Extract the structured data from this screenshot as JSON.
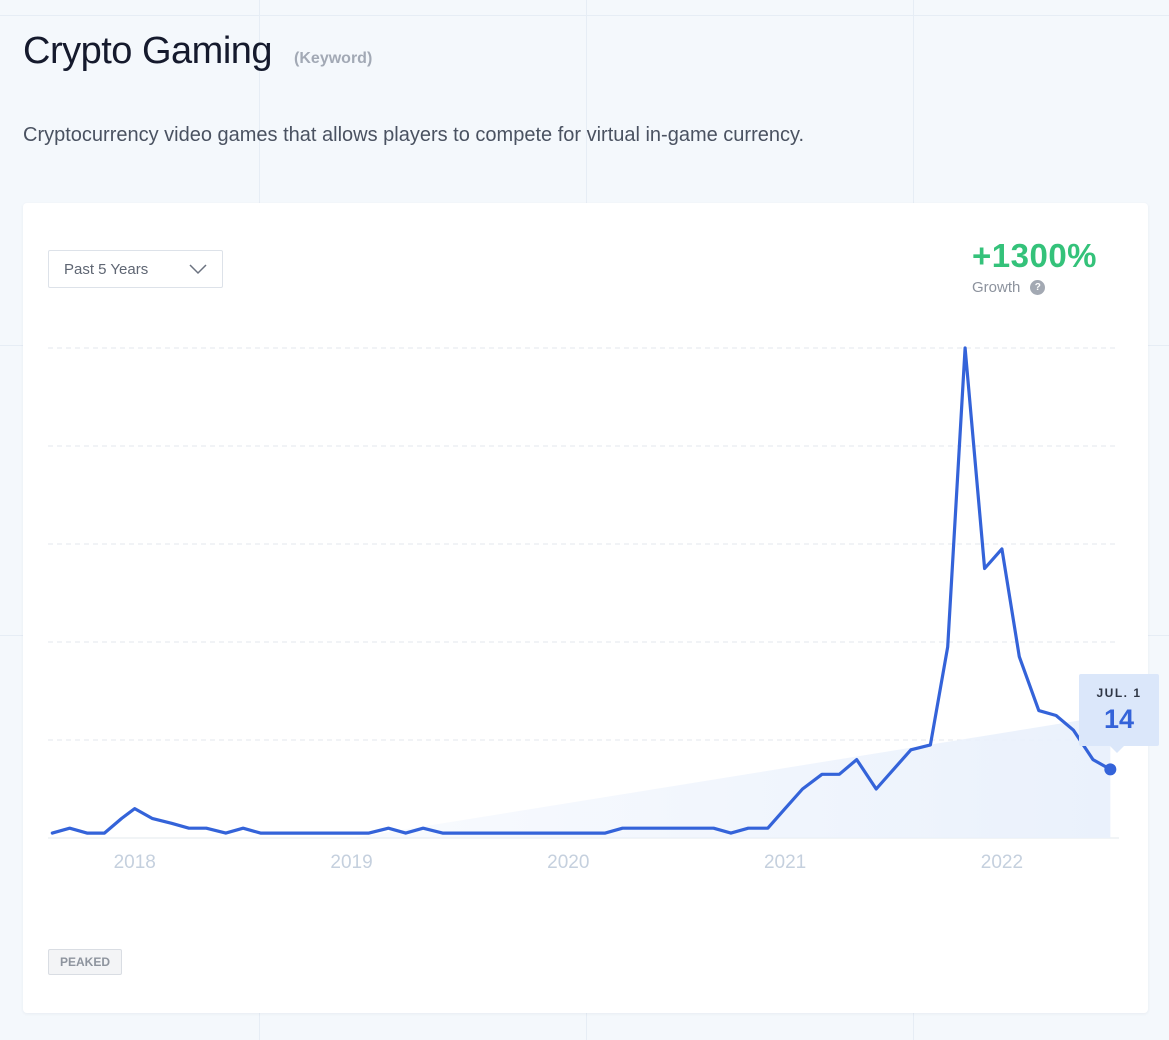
{
  "header": {
    "title": "Crypto Gaming",
    "type_tag": "(Keyword)",
    "description": "Cryptocurrency video games that allows players to compete for virtual in-game currency."
  },
  "controls": {
    "timeframe_label": "Past 5 Years",
    "timeframe_icon": "chevron-down-icon"
  },
  "growth": {
    "value": "+1300%",
    "label": "Growth",
    "help_icon": "question-circle-icon",
    "help_glyph": "?",
    "color": "#34c27a"
  },
  "status_badge": "PEAKED",
  "tooltip": {
    "date": "JUL. 1",
    "value": "14"
  },
  "colors": {
    "line": "#3463d9",
    "area": "#eaf1fc",
    "axis_text": "#c5d0de"
  },
  "chart_data": {
    "type": "line",
    "title": "",
    "xlabel": "",
    "ylabel": "",
    "x_ticks": [
      "2018",
      "2019",
      "2020",
      "2021",
      "2022"
    ],
    "x_range": [
      2017.6,
      2022.54
    ],
    "ylim": [
      0,
      100
    ],
    "grid": "horizontal dashed",
    "legend": "none",
    "series": [
      {
        "x": [
          2017.62,
          2017.7,
          2017.78,
          2017.86,
          2017.94,
          2018.0,
          2018.08,
          2018.17,
          2018.25,
          2018.33,
          2018.42,
          2018.5,
          2018.58,
          2018.67,
          2018.75,
          2018.83,
          2018.92,
          2019.0,
          2019.08,
          2019.17,
          2019.25,
          2019.33,
          2019.42,
          2019.5,
          2019.58,
          2019.67,
          2019.75,
          2019.83,
          2019.92,
          2020.0,
          2020.08,
          2020.17,
          2020.25,
          2020.33,
          2020.42,
          2020.5,
          2020.58,
          2020.67,
          2020.75,
          2020.83,
          2020.92,
          2021.0,
          2021.08,
          2021.17,
          2021.25,
          2021.33,
          2021.42,
          2021.5,
          2021.58,
          2021.67,
          2021.75,
          2021.83,
          2021.92,
          2022.0,
          2022.08,
          2022.17,
          2022.25,
          2022.33,
          2022.42,
          2022.5
        ],
        "y": [
          1,
          2,
          1,
          1,
          4,
          6,
          4,
          3,
          2,
          2,
          1,
          2,
          1,
          1,
          1,
          1,
          1,
          1,
          1,
          2,
          1,
          2,
          1,
          1,
          1,
          1,
          1,
          1,
          1,
          1,
          1,
          1,
          2,
          2,
          2,
          2,
          2,
          2,
          1,
          2,
          2,
          6,
          10,
          13,
          13,
          16,
          10,
          14,
          18,
          19,
          39,
          100,
          55,
          59,
          37,
          26,
          25,
          22,
          16,
          14
        ]
      }
    ]
  }
}
